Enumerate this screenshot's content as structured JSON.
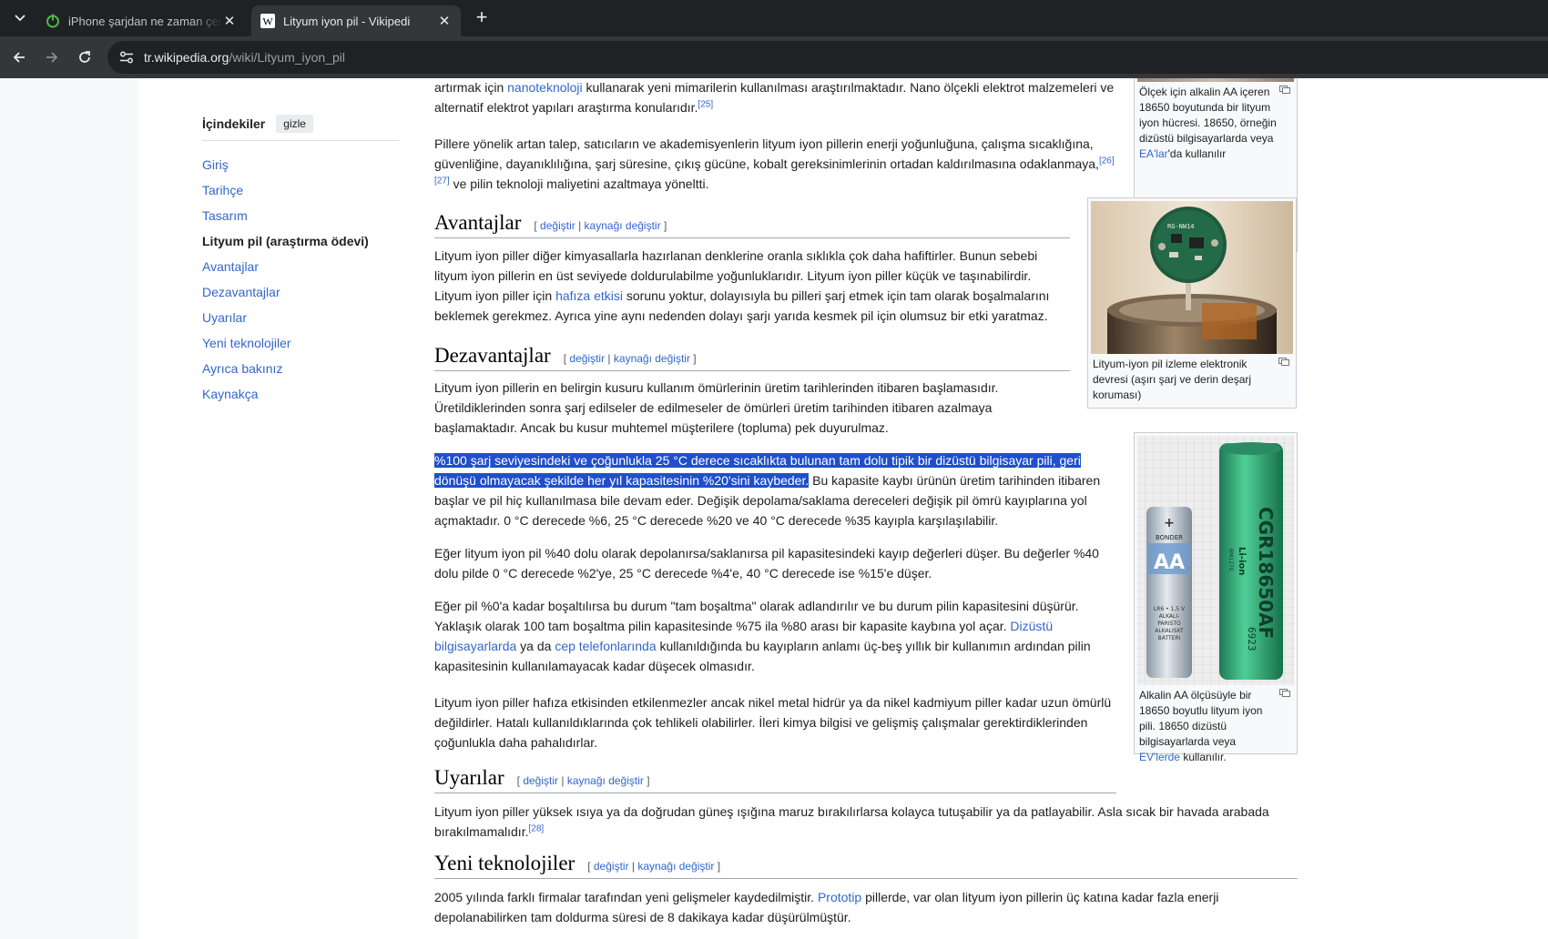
{
  "browser": {
    "tabs": [
      {
        "title": "iPhone şarjdan ne zaman çekilm",
        "active": false
      },
      {
        "title": "Lityum iyon pil - Vikipedi",
        "active": true
      }
    ],
    "url_host": "tr.wikipedia.org",
    "url_path": "/wiki/Lityum_iyon_pil",
    "icons": [
      "tab-list-icon",
      "power-favicon-icon",
      "wikipedia-favicon-icon",
      "close-icon",
      "new-tab-icon",
      "back-arrow-icon",
      "forward-arrow-icon",
      "reload-icon",
      "site-info-icon"
    ]
  },
  "toc": {
    "title": "İçindekiler",
    "toggle": "gizle",
    "items": [
      "Giriş",
      "Tarihçe",
      "Tasarım",
      "Lityum pil (araştırma ödevi)",
      "Avantajlar",
      "Dezavantajlar",
      "Uyarılar",
      "Yeni teknolojiler",
      "Ayrıca bakınız",
      "Kaynakça"
    ],
    "current_index": 3
  },
  "edit": {
    "edit": "değiştir",
    "sep": "|",
    "source": "kaynağı değiştir",
    "open": "[",
    "close": "]"
  },
  "content": {
    "p_top_a": "artırmak için ",
    "p_top_link": "nanoteknoloji",
    "p_top_b": " kullanarak yeni mimarilerin kullanılması araştırılmaktadır. Nano ölçekli elektrot malzemeleri ve alternatif elektrot yapıları araştırma konularıdır.",
    "p_top_ref": "[25]",
    "p_demand_a": "Pillere yönelik artan talep, satıcıların ve akademisyenlerin lityum iyon pillerin enerji yoğunluğuna, çalışma sıcaklığına, güvenliğine, dayanıklılığına, şarj süresine, çıkış gücüne, kobalt gereksinimlerinin ortadan kaldırılmasına odaklanmaya,",
    "p_demand_ref": "[26][27]",
    "p_demand_b": " ve pilin teknoloji maliyetini azaltmaya yöneltti.",
    "h_avantajlar": "Avantajlar",
    "p_adv_a": "Lityum iyon piller diğer kimyasallarla hazırlanan denklerine oranla sıklıkla çok daha hafiftirler. Bunun sebebi lityum iyon pillerin en üst seviyede doldurulabilme yoğunluklarıdır. Lityum iyon piller küçük ve taşınabilirdir. Lityum iyon piller için ",
    "p_adv_link": "hafıza etkisi",
    "p_adv_b": " sorunu yoktur, dolayısıyla bu pilleri şarj etmek için tam olarak boşalmalarını beklemek gerekmez. Ayrıca yine aynı nedenden dolayı şarjı yarıda kesmek pil için olumsuz bir etki yaratmaz.",
    "h_dezavantajlar": "Dezavantajlar",
    "p_dis1": "Lityum iyon pillerin en belirgin kusuru kullanım ömürlerinin üretim tarihlerinden itibaren başlamasıdır. Üretildiklerinden sonra şarj edilseler de edilmeseler de ömürleri üretim tarihinden itibaren azalmaya başlamaktadır. Ancak bu kusur muhtemel müşterilere (topluma) pek duyurulmaz.",
    "p_dis2_hl": "%100 şarj seviyesindeki ve çoğunlukla 25 °C derece sıcaklıkta bulunan tam dolu tipik bir dizüstü bilgisayar pili, geri dönüşü olmayacak şekilde her yıl kapasitesinin %20'sini kaybeder.",
    "p_dis2_rest": " Bu kapasite kaybı ürünün üretim tarihinden itibaren başlar ve pil hiç kullanılmasa bile devam eder. Değişik depolama/saklama dereceleri değişik pil ömrü kayıplarına yol açmaktadır. 0 °C derecede %6, 25 °C derecede %20 ve 40 °C derecede %35 kayıpla karşılaşılabilir.",
    "p_dis3": "Eğer lityum iyon pil %40 dolu olarak depolanırsa/saklanırsa pil kapasitesindeki kayıp değerleri düşer. Bu değerler %40 dolu pilde 0 °C derecede %2'ye, 25 °C derecede %4'e, 40 °C derecede ise %15'e düşer.",
    "p_dis4_a": "Eğer pil %0'a kadar boşaltılırsa bu durum \"tam boşaltma\" olarak adlandırılır ve bu durum pilin kapasitesini düşürür. Yaklaşık olarak 100 tam boşaltma pilin kapasitesinde %75 ila %80 arası bir kapasite kaybına yol açar. ",
    "p_dis4_link1": "Dizüstü bilgisayarlarda",
    "p_dis4_b": " ya da ",
    "p_dis4_link2": "cep telefonlarında",
    "p_dis4_c": " kullanıldığında bu kayıpların anlamı üç-beş yıllık bir kullanımın ardından pilin kapasitesinin kullanılamayacak kadar düşecek olmasıdır.",
    "p_dis5": "Lityum iyon piller hafıza etkisinden etkilenmezler ancak nikel metal hidrür ya da nikel kadmiyum piller kadar uzun ömürlü değildirler. Hatalı kullanıldıklarında çok tehlikeli olabilirler. İleri kimya bilgisi ve gelişmiş çalışmalar gerektirdiklerinden çoğunlukla daha pahalıdırlar.",
    "h_uyarilar": "Uyarılar",
    "p_warn": "Lityum iyon piller yüksek ısıya ya da doğrudan güneş ışığına maruz bırakılırlarsa kolayca tutuşabilir ya da patlayabilir. Asla sıcak bir havada arabada bırakılmamalıdır.",
    "p_warn_ref": "[28]",
    "h_yeni": "Yeni teknolojiler",
    "p_new_a": "2005 yılında farklı firmalar tarafından yeni gelişmeler kaydedilmiştir. ",
    "p_new_link": "Prototip",
    "p_new_b": " pillerde, var olan lityum iyon pillerin üç katına kadar fazla enerji depolanabilirken tam doldurma süresi de 8 dakikaya kadar düşürülmüştür."
  },
  "figures": {
    "fig1_cap_a": "Ölçek için alkalin AA içeren 18650 boyutunda bir lityum iyon hücresi. 18650, örneğin dizüstü bilgisayarlarda veya ",
    "fig1_cap_link": "EA'lar",
    "fig1_cap_b": "'da kullanılır",
    "fig2_cap": "Lityum-iyon pil izleme elektronik devresi (aşırı şarj ve derin deşarj koruması)",
    "fig3_cap_a": "Alkalin AA ölçüsüyle bir 18650 boyutlu lityum iyon pili. 18650 dizüstü bilgisayarlarda veya ",
    "fig3_cap_link": "EV'lerde",
    "fig3_cap_b": " kullanılır.",
    "fig2_board_text": "RG-NW14",
    "fig3_aa_label": "AA",
    "fig3_aa_plus": "+",
    "fig3_aa_brand": "BONDER",
    "fig3_aa_small": [
      "LR6 • 1,5 V",
      "ALKALI-",
      "PARISTO",
      "ALKALISKT",
      "BATTERI"
    ],
    "fig3_cell_model": "CGR18650AF",
    "fig3_cell_type": "Li-ion",
    "fig3_cell_batch": "6923",
    "fig3_cell_sub": "BM1270"
  }
}
